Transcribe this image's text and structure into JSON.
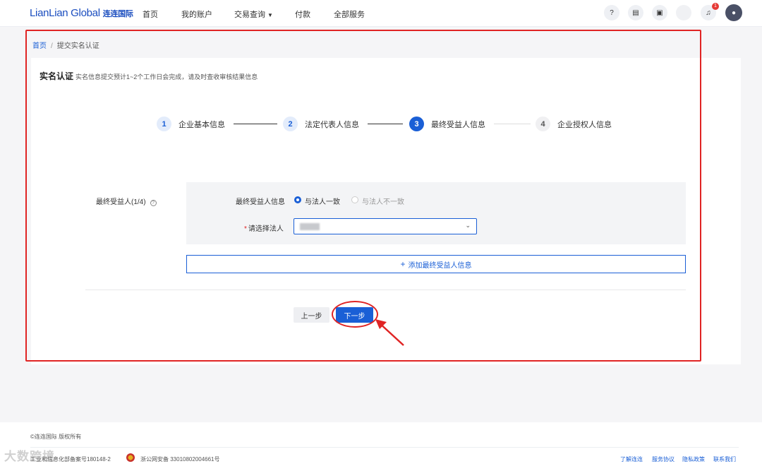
{
  "brand": {
    "name": "LianLian Global",
    "name_cn": "连连国际"
  },
  "nav": {
    "items": [
      "首页",
      "我的账户",
      "交易查询",
      "付款",
      "全部服务"
    ],
    "notification_count": "1"
  },
  "breadcrumb": {
    "home": "首页",
    "separator": "/",
    "current": "提交实名认证"
  },
  "page": {
    "title": "实名认证",
    "subtitle": "实名信息提交预计1~2个工作日会完成，请及时查收审核结果信息"
  },
  "steps": [
    {
      "num": "1",
      "label": "企业基本信息",
      "state": "done"
    },
    {
      "num": "2",
      "label": "法定代表人信息",
      "state": "done"
    },
    {
      "num": "3",
      "label": "最终受益人信息",
      "state": "active"
    },
    {
      "num": "4",
      "label": "企业授权人信息",
      "state": "pending"
    }
  ],
  "form": {
    "ubo_label": "最终受益人(1/4)",
    "info_label": "最终受益人信息",
    "radio_options": [
      {
        "label": "与法人一致",
        "checked": true
      },
      {
        "label": "与法人不一致",
        "checked": false
      }
    ],
    "select_label": "请选择法人",
    "required_mark": "*",
    "add_button": "添加最终受益人信息"
  },
  "actions": {
    "prev": "上一步",
    "next": "下一步"
  },
  "footer": {
    "copyright": "©连连国际 版权所有",
    "icp": "工业和信息化部备案号180148-2",
    "police": "浙公网安备 33010802004661号",
    "links": [
      "了解连连",
      "服务协议",
      "隐私政策",
      "联系我们"
    ]
  },
  "watermark": "大数跨境",
  "colors": {
    "primary": "#1a5fd6",
    "annotation": "#e02424"
  }
}
